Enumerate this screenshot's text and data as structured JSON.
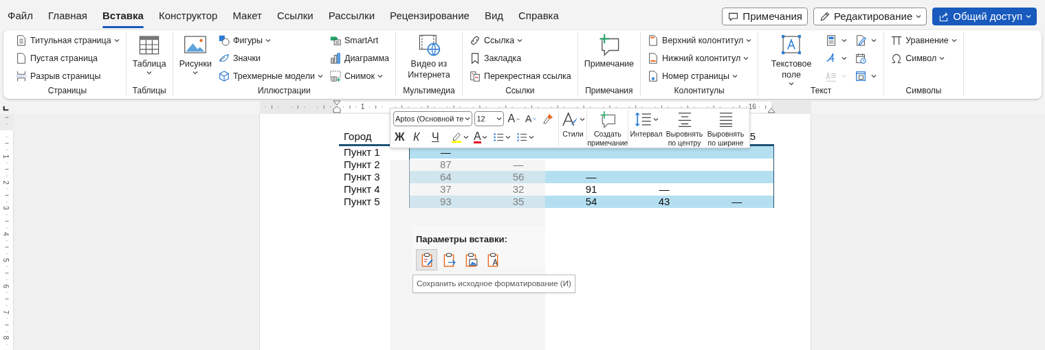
{
  "menu_tabs": [
    {
      "label": "Файл",
      "selected": false
    },
    {
      "label": "Главная",
      "selected": false
    },
    {
      "label": "Вставка",
      "selected": true
    },
    {
      "label": "Конструктор",
      "selected": false
    },
    {
      "label": "Макет",
      "selected": false
    },
    {
      "label": "Ссылки",
      "selected": false
    },
    {
      "label": "Рассылки",
      "selected": false
    },
    {
      "label": "Рецензирование",
      "selected": false
    },
    {
      "label": "Вид",
      "selected": false
    },
    {
      "label": "Справка",
      "selected": false
    }
  ],
  "header_buttons": [
    {
      "label": "Примечания",
      "kind": "comments",
      "dropdown": false
    },
    {
      "label": "Редактирование",
      "kind": "editing",
      "dropdown": true
    },
    {
      "label": "Общий доступ",
      "kind": "share",
      "dropdown": true
    }
  ],
  "ribbon": {
    "groups": [
      {
        "label": "Страницы",
        "items": [
          {
            "label": "Титульная страница",
            "kind": "small",
            "dropdown": true
          },
          {
            "label": "Пустая страница",
            "kind": "small",
            "dropdown": false
          },
          {
            "label": "Разрыв страницы",
            "kind": "small",
            "dropdown": false
          }
        ]
      },
      {
        "label": "Таблицы",
        "items": [
          {
            "label": "Таблица",
            "kind": "large",
            "dropdown": true
          }
        ]
      },
      {
        "label": "Иллюстрации",
        "items": [
          {
            "label": "Рисунки",
            "kind": "large",
            "dropdown": true
          },
          {
            "label": "Фигуры",
            "kind": "small",
            "dropdown": true
          },
          {
            "label": "Значки",
            "kind": "small",
            "dropdown": false
          },
          {
            "label": "Трехмерные модели",
            "kind": "small",
            "dropdown": true
          },
          {
            "label": "SmartArt",
            "kind": "small",
            "dropdown": false
          },
          {
            "label": "Диаграмма",
            "kind": "small",
            "dropdown": false
          },
          {
            "label": "Снимок",
            "kind": "small",
            "dropdown": true
          }
        ]
      },
      {
        "label": "Мультимедиа",
        "items": [
          {
            "label": "Видео из Интернета",
            "kind": "large",
            "dropdown": false
          }
        ]
      },
      {
        "label": "Ссылки",
        "items": [
          {
            "label": "Ссылка",
            "kind": "small",
            "dropdown": true
          },
          {
            "label": "Закладка",
            "kind": "small",
            "dropdown": false
          },
          {
            "label": "Перекрестная ссылка",
            "kind": "small",
            "dropdown": false
          }
        ]
      },
      {
        "label": "Примечания",
        "items": [
          {
            "label": "Примечание",
            "kind": "large",
            "dropdown": false
          }
        ]
      },
      {
        "label": "Колонтитулы",
        "items": [
          {
            "label": "Верхний колонтитул",
            "kind": "small",
            "dropdown": true
          },
          {
            "label": "Нижний колонтитул",
            "kind": "small",
            "dropdown": true
          },
          {
            "label": "Номер страницы",
            "kind": "small",
            "dropdown": true
          }
        ]
      },
      {
        "label": "Текст",
        "items": [
          {
            "label": "Текстовое поле",
            "kind": "large",
            "dropdown": true,
            "disabled": false
          },
          {
            "kind": "icon",
            "dropdown": true,
            "disabled": false
          },
          {
            "kind": "icon",
            "dropdown": true,
            "disabled": false
          },
          {
            "kind": "icon",
            "dropdown": true,
            "disabled": true
          },
          {
            "kind": "icon",
            "dropdown": true,
            "disabled": false
          },
          {
            "kind": "icon",
            "dropdown": false,
            "disabled": false
          },
          {
            "kind": "icon",
            "dropdown": true,
            "disabled": false
          }
        ]
      },
      {
        "label": "Символы",
        "items": [
          {
            "label": "Уравнение",
            "kind": "small",
            "dropdown": true
          },
          {
            "label": "Символ",
            "kind": "small",
            "dropdown": true
          }
        ]
      }
    ]
  },
  "horizontal_ruler": [
    "1",
    "16"
  ],
  "vertical_ruler": [
    "1",
    "2",
    "3",
    "4",
    "5",
    "6",
    "7",
    "8"
  ],
  "table": {
    "columns": [
      "Город",
      "",
      "",
      "",
      "",
      "5"
    ],
    "rows": [
      {
        "label": "Пункт 1",
        "cells": [
          "—"
        ]
      },
      {
        "label": "Пункт 2",
        "cells": [
          "87",
          "—"
        ]
      },
      {
        "label": "Пункт 3",
        "cells": [
          "64",
          "56",
          "—"
        ]
      },
      {
        "label": "Пункт 4",
        "cells": [
          "37",
          "32",
          "91",
          "—"
        ]
      },
      {
        "label": "Пункт 5",
        "cells": [
          "93",
          "35",
          "54",
          "43",
          "—"
        ]
      }
    ]
  },
  "mini_toolbar": {
    "font": "Aptos (Основной те",
    "size": "12",
    "grow_font": "A",
    "shrink_font": "A",
    "format_buttons": [
      {
        "label": "Ж",
        "kind": "bold"
      },
      {
        "label": "К",
        "kind": "italic"
      },
      {
        "label": "Ч",
        "kind": "underline"
      }
    ],
    "font_color": "A",
    "buttons": [
      {
        "label": "Стили",
        "dropdown": true
      },
      {
        "label": "Создать примечание",
        "dropdown": false
      },
      {
        "label": "Интервал",
        "dropdown": true
      },
      {
        "label": "Выровнять по центру",
        "dropdown": false
      },
      {
        "label": "Выровнять по ширине",
        "dropdown": false
      }
    ]
  },
  "paste_options": {
    "title": "Параметры вставки:",
    "options": [
      {
        "selected": true
      },
      {
        "selected": false
      },
      {
        "selected": false
      },
      {
        "selected": false
      }
    ]
  },
  "tooltip": "Сохранить исходное форматирование (И)"
}
